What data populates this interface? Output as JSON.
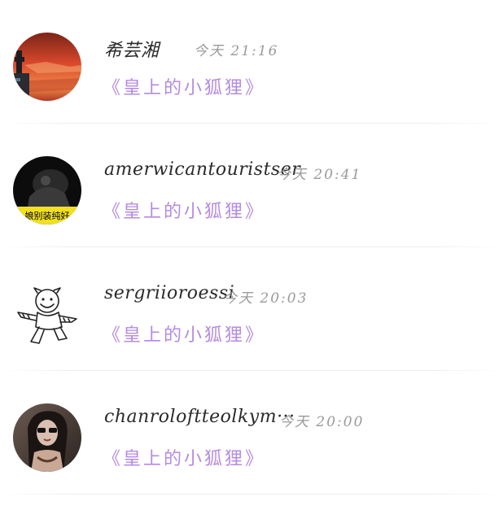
{
  "items": [
    {
      "username": "希芸湘",
      "time": "今天 21:16",
      "source": "《皇上的小狐狸》",
      "avatar": "sunset-avatar"
    },
    {
      "username": "amerwicantouristser",
      "time": "今天 20:41",
      "source": "《皇上的小狐狸》",
      "avatar": "dark-photo-avatar",
      "avatar_caption": "娘别装纯好"
    },
    {
      "username": "sergriioroessi",
      "time": "今天 20:03",
      "source": "《皇上的小狐狸》",
      "avatar": "cartoon-tiger-avatar"
    },
    {
      "username": "chanroloftteolkym···",
      "time": "今天 20:00",
      "source": "《皇上的小狐狸》",
      "avatar": "portrait-avatar"
    }
  ],
  "colors": {
    "link": "#b48be0",
    "name": "#2a2a2a",
    "time": "#9a9a9a"
  }
}
